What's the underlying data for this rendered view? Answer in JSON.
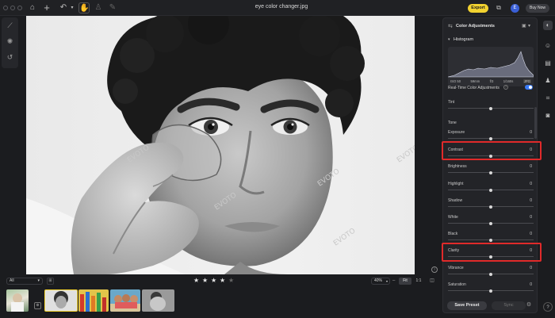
{
  "window": {
    "title": "eye color changer.jpg"
  },
  "toolbar": {
    "export_label": "Export",
    "avatar_letter": "E",
    "buy_label": "Buy Now"
  },
  "panel": {
    "title": "Color Adjustments",
    "histogram_label": "Histogram",
    "hist": {
      "iso": "ISO 50",
      "focal": "59mm",
      "aperture": "f/3",
      "shutter": "1/160s",
      "format": "JPG"
    },
    "realtime_label": "Real-Time Color Adjustments",
    "tone_label": "Tone",
    "save_preset": "Save Preset",
    "sync": "Sync",
    "sliders": [
      {
        "label": "Tint",
        "value": "",
        "position": 0.5
      },
      {
        "label": "Exposure",
        "value": "0",
        "position": 0.5
      },
      {
        "label": "Contrast",
        "value": "0",
        "position": 0.5
      },
      {
        "label": "Brightness",
        "value": "0",
        "position": 0.5
      },
      {
        "label": "Highlight",
        "value": "0",
        "position": 0.5
      },
      {
        "label": "Shadow",
        "value": "0",
        "position": 0.5
      },
      {
        "label": "White",
        "value": "0",
        "position": 0.5
      },
      {
        "label": "Black",
        "value": "0",
        "position": 0.5
      },
      {
        "label": "Clarity",
        "value": "0",
        "position": 0.5
      },
      {
        "label": "Vibrance",
        "value": "0",
        "position": 0.5
      },
      {
        "label": "Saturation",
        "value": "0",
        "position": 0.5
      }
    ]
  },
  "filmstrip": {
    "filter": "All",
    "rating": 4,
    "rating_max": 5,
    "zoom": "40%",
    "fit": "Fit",
    "one": "1:1"
  },
  "watermark": "EVOTO",
  "colors": {
    "accent": "#f2d230",
    "highlight": "#e02a2a",
    "toggle": "#3a7bf7"
  }
}
